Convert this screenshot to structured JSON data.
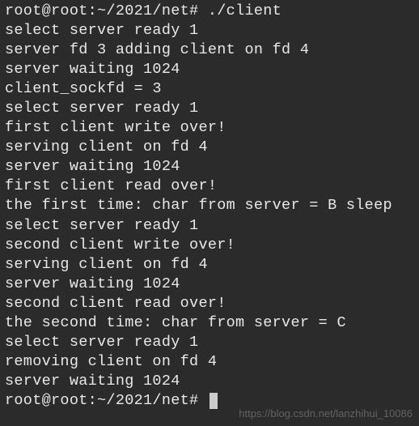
{
  "prompt": {
    "user_host": "root@root",
    "path": "~/2021/net",
    "marker": "#",
    "full": "root@root:~/2021/net#"
  },
  "command": "./client",
  "output": [
    "select server ready 1",
    "server fd 3 adding client on fd 4",
    "server waiting 1024",
    "client_sockfd = 3",
    "select server ready 1",
    "first client write over!",
    "serving client on fd 4",
    "server waiting 1024",
    "first client read over!",
    "the first time: char from server = B sleep",
    "select server ready 1",
    "second client write over!",
    "serving client on fd 4",
    "server waiting 1024",
    "second client read over!",
    "the second time: char from server = C",
    "select server ready 1",
    "removing client on fd 4",
    "server waiting 1024"
  ],
  "watermark": "https://blog.csdn.net/lanzhihui_10086",
  "space": " "
}
